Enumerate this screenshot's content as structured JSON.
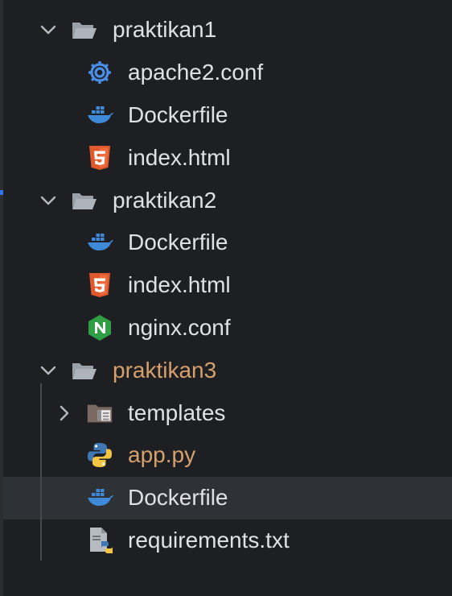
{
  "tree": [
    {
      "type": "folder",
      "label": "praktikan1",
      "expanded": true,
      "icon": "folder-open-icon",
      "level": 0
    },
    {
      "type": "file",
      "label": "apache2.conf",
      "icon": "gear-icon",
      "level": 1
    },
    {
      "type": "file",
      "label": "Dockerfile",
      "icon": "docker-icon",
      "level": 1
    },
    {
      "type": "file",
      "label": "index.html",
      "icon": "html5-icon",
      "level": 1
    },
    {
      "type": "folder",
      "label": "praktikan2",
      "expanded": true,
      "icon": "folder-open-icon",
      "level": 0
    },
    {
      "type": "file",
      "label": "Dockerfile",
      "icon": "docker-icon",
      "level": 1
    },
    {
      "type": "file",
      "label": "index.html",
      "icon": "html5-icon",
      "level": 1
    },
    {
      "type": "file",
      "label": "nginx.conf",
      "icon": "nginx-icon",
      "level": 1
    },
    {
      "type": "folder",
      "label": "praktikan3",
      "expanded": true,
      "icon": "folder-open-icon",
      "level": 0,
      "modified": true
    },
    {
      "type": "folder",
      "label": "templates",
      "expanded": false,
      "icon": "templates-folder-icon",
      "level": 1
    },
    {
      "type": "file",
      "label": "app.py",
      "icon": "python-icon",
      "level": 1,
      "modified": true
    },
    {
      "type": "file",
      "label": "Dockerfile",
      "icon": "docker-icon",
      "level": 1,
      "selected": true
    },
    {
      "type": "file",
      "label": "requirements.txt",
      "icon": "requirements-file-icon",
      "level": 1
    }
  ],
  "colors": {
    "background": "#1e1f22",
    "text": "#dfe1e5",
    "modified_text": "#d5a06c",
    "selection": "#2e3136",
    "gear_blue": "#4a8fe7",
    "docker_blue": "#3f8ad8",
    "html_orange": "#e0592d",
    "nginx_green": "#2f9e44",
    "python_blue": "#3f77b5",
    "python_yellow": "#f4c542"
  }
}
